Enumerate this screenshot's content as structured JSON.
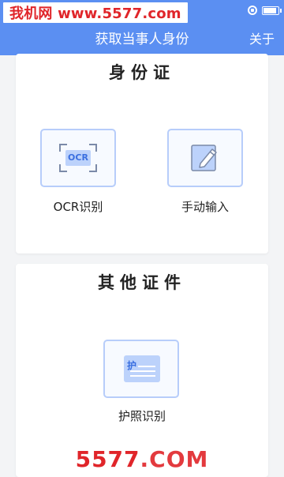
{
  "watermark_top": "我机网 www.5577.com",
  "nav": {
    "title": "获取当事人身份",
    "about": "关于"
  },
  "id_card": {
    "title": "身份证",
    "ocr": {
      "icon_text": "OCR",
      "label": "OCR识别",
      "icon": "ocr-scan-icon"
    },
    "manual": {
      "label": "手动输入",
      "icon": "edit-pencil-icon"
    }
  },
  "other": {
    "title": "其他证件",
    "passport": {
      "icon_text": "护",
      "label": "护照识别",
      "icon": "passport-card-icon"
    }
  },
  "watermark_bottom": {
    "num": "5577",
    "domain": ".COM"
  },
  "colors": {
    "nav": "#5b8ff2",
    "tile_border": "#b7cdfa",
    "accent": "#3a6fe0",
    "watermark": "#e0252a"
  }
}
